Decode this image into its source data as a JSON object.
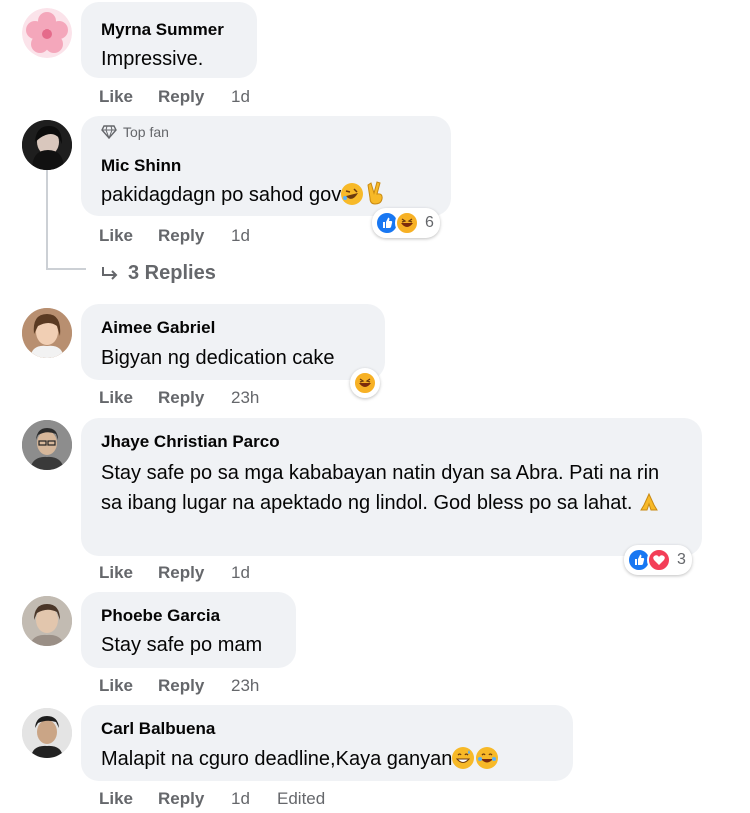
{
  "comments": [
    {
      "name": "Myrna Summer",
      "text": "Impressive.",
      "like": "Like",
      "reply": "Reply",
      "time": "1d"
    },
    {
      "badge": "Top fan",
      "name": "Mic Shinn",
      "text": "pakidagdagn po sahod gov",
      "like": "Like",
      "reply": "Reply",
      "time": "1d",
      "reaction_count": "6",
      "replies_label": "3 Replies"
    },
    {
      "name": "Aimee Gabriel",
      "text": "Bigyan ng dedication cake",
      "like": "Like",
      "reply": "Reply",
      "time": "23h"
    },
    {
      "name": "Jhaye Christian Parco",
      "text": "Stay safe po sa mga kababayan natin dyan sa Abra. Pati na rin sa ibang lugar na apektado ng lindol. God bless po sa lahat.",
      "like": "Like",
      "reply": "Reply",
      "time": "1d",
      "reaction_count": "3"
    },
    {
      "name": "Phoebe Garcia",
      "text": "Stay safe po mam",
      "like": "Like",
      "reply": "Reply",
      "time": "23h"
    },
    {
      "name": "Carl Balbuena",
      "text": "Malapit na cguro deadline,Kaya ganyan",
      "like": "Like",
      "reply": "Reply",
      "time": "1d",
      "edited": "Edited"
    }
  ],
  "colors": {
    "bubble": "#f0f2f5",
    "meta": "#65676b",
    "like_blue": "#1877f2",
    "haha_yellow": "#f7b125",
    "love_red": "#f33e58"
  }
}
